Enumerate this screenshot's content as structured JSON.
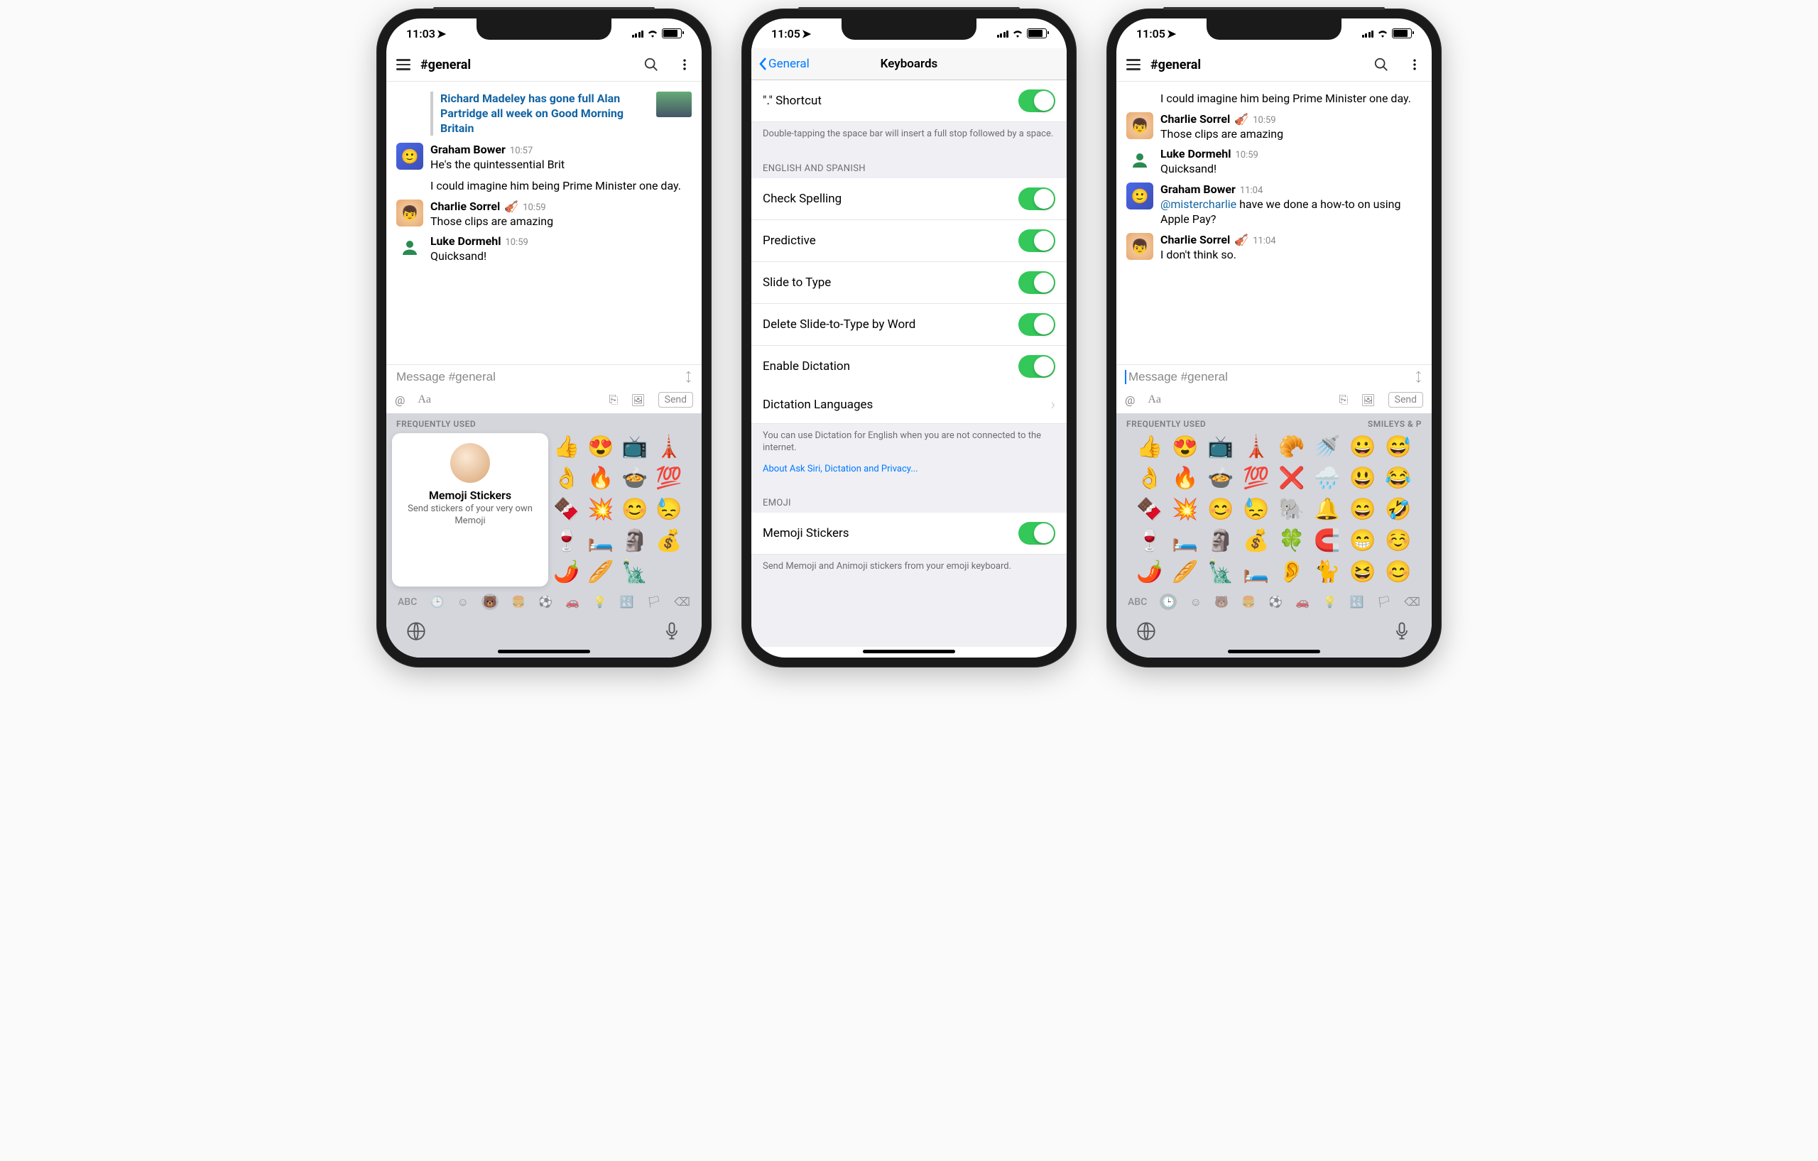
{
  "phone1": {
    "time": "11:03",
    "channel": "#general",
    "link_title": "Richard Madeley has gone full Alan Partridge all week on Good Morning Britain",
    "m1_name": "Graham Bower",
    "m1_time": "10:57",
    "m1_l1": "He's the quintessential Brit",
    "m1_l2": "I could imagine him being Prime Minister one day.",
    "m2_name": "Charlie Sorrel",
    "m2_badge": "🎻",
    "m2_time": "10:59",
    "m2_text": "Those clips are amazing",
    "m3_name": "Luke Dormehl",
    "m3_time": "10:59",
    "m3_text": "Quicksand!",
    "composer_ph": "Message #general",
    "send": "Send",
    "freq_label": "FREQUENTLY USED",
    "memoji_title": "Memoji Stickers",
    "memoji_sub": "Send stickers of your very own Memoji",
    "abc": "ABC",
    "emoji_rows": [
      [
        "👍",
        "😍",
        "📺",
        "🗼"
      ],
      [
        "👌",
        "🔥",
        "🍲",
        "💯"
      ],
      [
        "🍫",
        "💥",
        "😊",
        "😓"
      ],
      [
        "🍷",
        "🛏️",
        "🗿",
        "💰"
      ],
      [
        "🌶️",
        "🥖",
        "🗽",
        ""
      ]
    ]
  },
  "phone2": {
    "time": "11:05",
    "back": "General",
    "title": "Keyboards",
    "shortcut_label": "\".\" Shortcut",
    "shortcut_foot": "Double-tapping the space bar will insert a full stop followed by a space.",
    "lang_head": "ENGLISH AND SPANISH",
    "rows": [
      "Check Spelling",
      "Predictive",
      "Slide to Type",
      "Delete Slide-to-Type by Word",
      "Enable Dictation"
    ],
    "dict_lang": "Dictation Languages",
    "dict_foot": "You can use Dictation for English when you are not connected to the internet.",
    "dict_link": "About Ask Siri, Dictation and Privacy...",
    "emoji_head": "EMOJI",
    "memoji_row": "Memoji Stickers",
    "memoji_foot": "Send Memoji and Animoji stickers from your emoji keyboard."
  },
  "phone3": {
    "time": "11:05",
    "channel": "#general",
    "m0_text": "I could imagine him being Prime Minister one day.",
    "m1_name": "Charlie Sorrel",
    "m1_badge": "🎻",
    "m1_time": "10:59",
    "m1_text": "Those clips are amazing",
    "m2_name": "Luke Dormehl",
    "m2_time": "10:59",
    "m2_text": "Quicksand!",
    "m3_name": "Graham Bower",
    "m3_time": "11:04",
    "m3_mention": "@mistercharlie",
    "m3_text": " have we done a how-to on using Apple Pay?",
    "m4_name": "Charlie Sorrel",
    "m4_badge": "🎻",
    "m4_time": "11:04",
    "m4_text": "I don't think so.",
    "composer_ph": "Message #general",
    "send": "Send",
    "freq_label": "FREQUENTLY USED",
    "smiley_label": "SMILEYS & P",
    "abc": "ABC",
    "emoji_rows": [
      [
        "👍",
        "😍",
        "📺",
        "🗼",
        "🥐",
        "🚿",
        "😀",
        "😅"
      ],
      [
        "👌",
        "🔥",
        "🍲",
        "💯",
        "❌",
        "🌧️",
        "😃",
        "😂"
      ],
      [
        "🍫",
        "💥",
        "😊",
        "😓",
        "🐘",
        "🔔",
        "😄",
        "🤣"
      ],
      [
        "🍷",
        "🛏️",
        "🗿",
        "💰",
        "🍀",
        "🧲",
        "😁",
        "☺️"
      ],
      [
        "🌶️",
        "🥖",
        "🗽",
        "🛏️",
        "👂",
        "🐈",
        "😆",
        "😊"
      ]
    ]
  }
}
